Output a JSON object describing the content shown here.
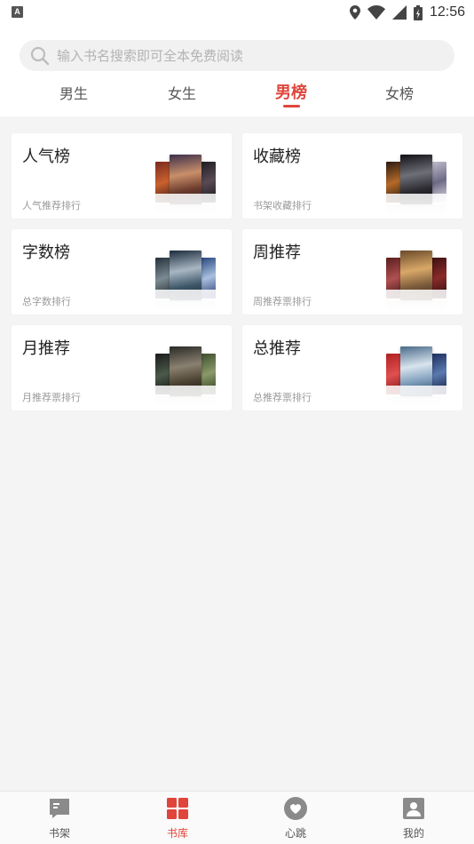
{
  "status_bar": {
    "time": "12:56",
    "app_indicator": "A"
  },
  "search": {
    "placeholder": "输入书名搜索即可全本免费阅读",
    "icon": "search-icon"
  },
  "tabs": [
    {
      "label": "男生",
      "active": false
    },
    {
      "label": "女生",
      "active": false
    },
    {
      "label": "男榜",
      "active": true
    },
    {
      "label": "女榜",
      "active": false
    }
  ],
  "rankings": [
    {
      "title": "人气榜",
      "subtitle": "人气推荐排行"
    },
    {
      "title": "收藏榜",
      "subtitle": "书架收藏排行"
    },
    {
      "title": "字数榜",
      "subtitle": "总字数排行"
    },
    {
      "title": "周推荐",
      "subtitle": "周推荐票排行"
    },
    {
      "title": "月推荐",
      "subtitle": "月推荐票排行"
    },
    {
      "title": "总推荐",
      "subtitle": "总推荐票排行"
    }
  ],
  "bottom_nav": [
    {
      "label": "书架",
      "icon": "bookshelf-icon",
      "active": false
    },
    {
      "label": "书库",
      "icon": "library-grid-icon",
      "active": true
    },
    {
      "label": "心跳",
      "icon": "heart-icon",
      "active": false
    },
    {
      "label": "我的",
      "icon": "profile-icon",
      "active": false
    }
  ],
  "colors": {
    "accent": "#e0453b",
    "background": "#f4f4f4",
    "muted_text": "#9a9a9a"
  }
}
